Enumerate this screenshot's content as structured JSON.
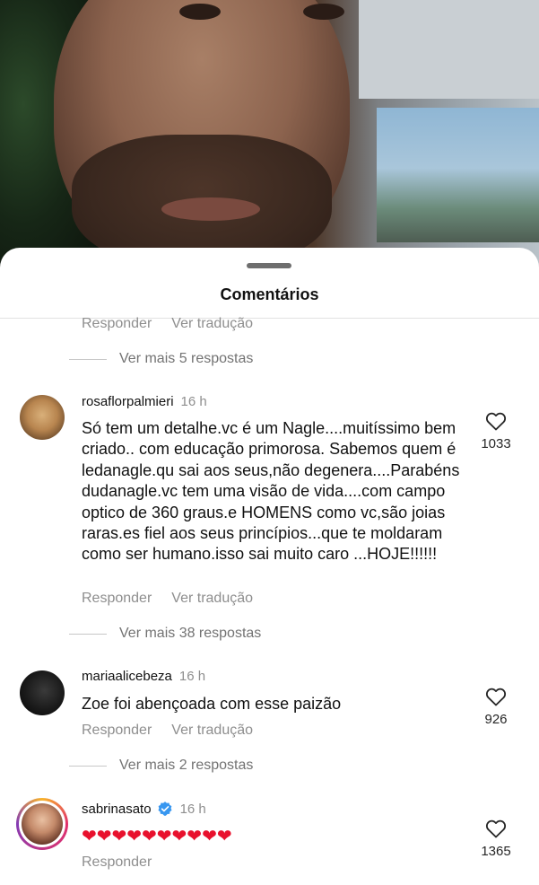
{
  "sheet": {
    "title": "Comentários"
  },
  "top_actions": {
    "reply": "Responder",
    "translate": "Ver tradução"
  },
  "comments": [
    {
      "username": "rosaflorpalmieri",
      "time": "16 h",
      "text": "Só tem um detalhe.vc é um Nagle....muitíssimo bem criado.. com educação primorosa. Sabemos quem é ledanagle.qu sai aos seus,não degenera....Parabéns dudanagle.vc tem uma visão de vida....com campo optico de 360 graus.e HOMENS como vc,são joias raras.es fiel aos seus princípios...que te moldaram como ser humano.isso sai muito caro ...HOJE!!!!!!",
      "likes": "1033",
      "reply": "Responder",
      "translate": "Ver tradução"
    },
    {
      "username": "mariaalicebeza",
      "time": "16 h",
      "text": "Zoe foi abençoada com esse paizão",
      "likes": "926",
      "reply": "Responder",
      "translate": "Ver tradução"
    },
    {
      "username": "sabrinasato",
      "time": "16 h",
      "text": "❤❤❤❤❤❤❤❤❤❤",
      "likes": "1365",
      "reply": "Responder"
    }
  ],
  "more_replies": [
    "Ver mais 5 respostas",
    "Ver mais 38 respostas",
    "Ver mais 2 respostas"
  ],
  "icons": {
    "like": "heart-outline-icon",
    "verified": "verified-badge-icon"
  },
  "colors": {
    "verified": "#3897f0",
    "hearts": "#e8112d",
    "muted": "#8e8e8e"
  }
}
